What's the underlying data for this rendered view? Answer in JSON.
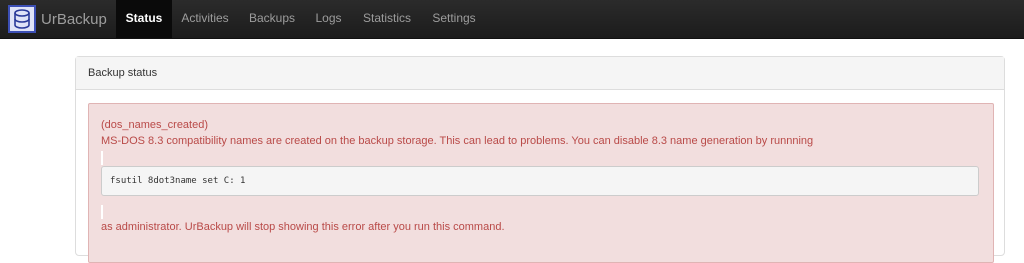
{
  "app": {
    "brand_name": "UrBackup",
    "logo_icon": "database-icon",
    "colors": {
      "navbar": "#222222",
      "active_tab": "#0a0a0a",
      "alert_background": "#f2dede",
      "alert_text": "#b94a48"
    }
  },
  "nav": {
    "items": [
      {
        "label": "Status",
        "active": true
      },
      {
        "label": "Activities",
        "active": false
      },
      {
        "label": "Backups",
        "active": false
      },
      {
        "label": "Logs",
        "active": false
      },
      {
        "label": "Statistics",
        "active": false
      },
      {
        "label": "Settings",
        "active": false
      }
    ]
  },
  "panel": {
    "title": "Backup status"
  },
  "alert": {
    "code_name": "(dos_names_created)",
    "message": "MS-DOS 8.3 compatibility names are created on the backup storage. This can lead to problems. You can disable 8.3 name generation by runnning",
    "command": "fsutil 8dot3name set C: 1",
    "footer": "as administrator. UrBackup will stop showing this error after you run this command."
  }
}
